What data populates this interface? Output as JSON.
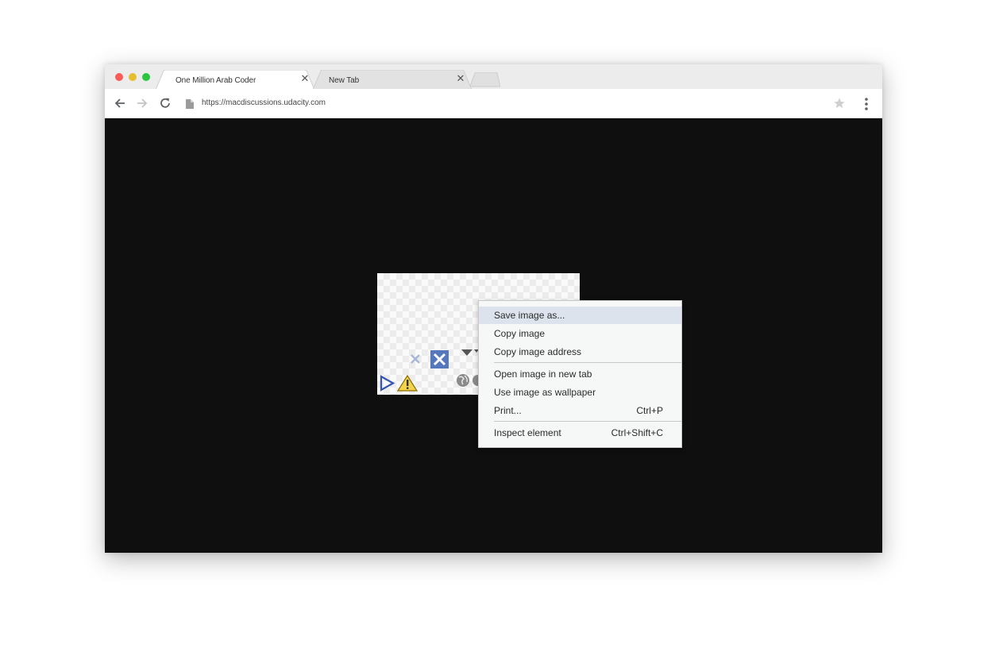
{
  "browser": {
    "tabs": [
      {
        "title": "One Million Arab Coder",
        "active": true
      },
      {
        "title": "New Tab",
        "active": false
      }
    ],
    "address_bar": {
      "url": "https://macdiscussions.udacity.com"
    },
    "icons": [
      "back-icon",
      "forward-icon",
      "reload-icon",
      "page-icon",
      "bookmark-star-icon",
      "menu-dots-icon"
    ]
  },
  "context_menu": {
    "items": [
      {
        "label": "Save image as...",
        "shortcut": ""
      },
      {
        "label": "Copy image",
        "shortcut": ""
      },
      {
        "label": "Copy image address",
        "shortcut": ""
      },
      {
        "label": "Open image in new tab",
        "shortcut": ""
      },
      {
        "label": "Use image as wallpaper",
        "shortcut": ""
      },
      {
        "label": "Print...",
        "shortcut": "Ctrl+P"
      },
      {
        "label": "Inspect element",
        "shortcut": "Ctrl+Shift+C"
      }
    ]
  },
  "colors": {
    "viewport_bg": "#0f0f0f",
    "menu_highlight": "#dde3ec",
    "traffic_red": "#fc5b57",
    "traffic_yellow": "#e5bf2f",
    "traffic_green": "#2ac63f"
  }
}
